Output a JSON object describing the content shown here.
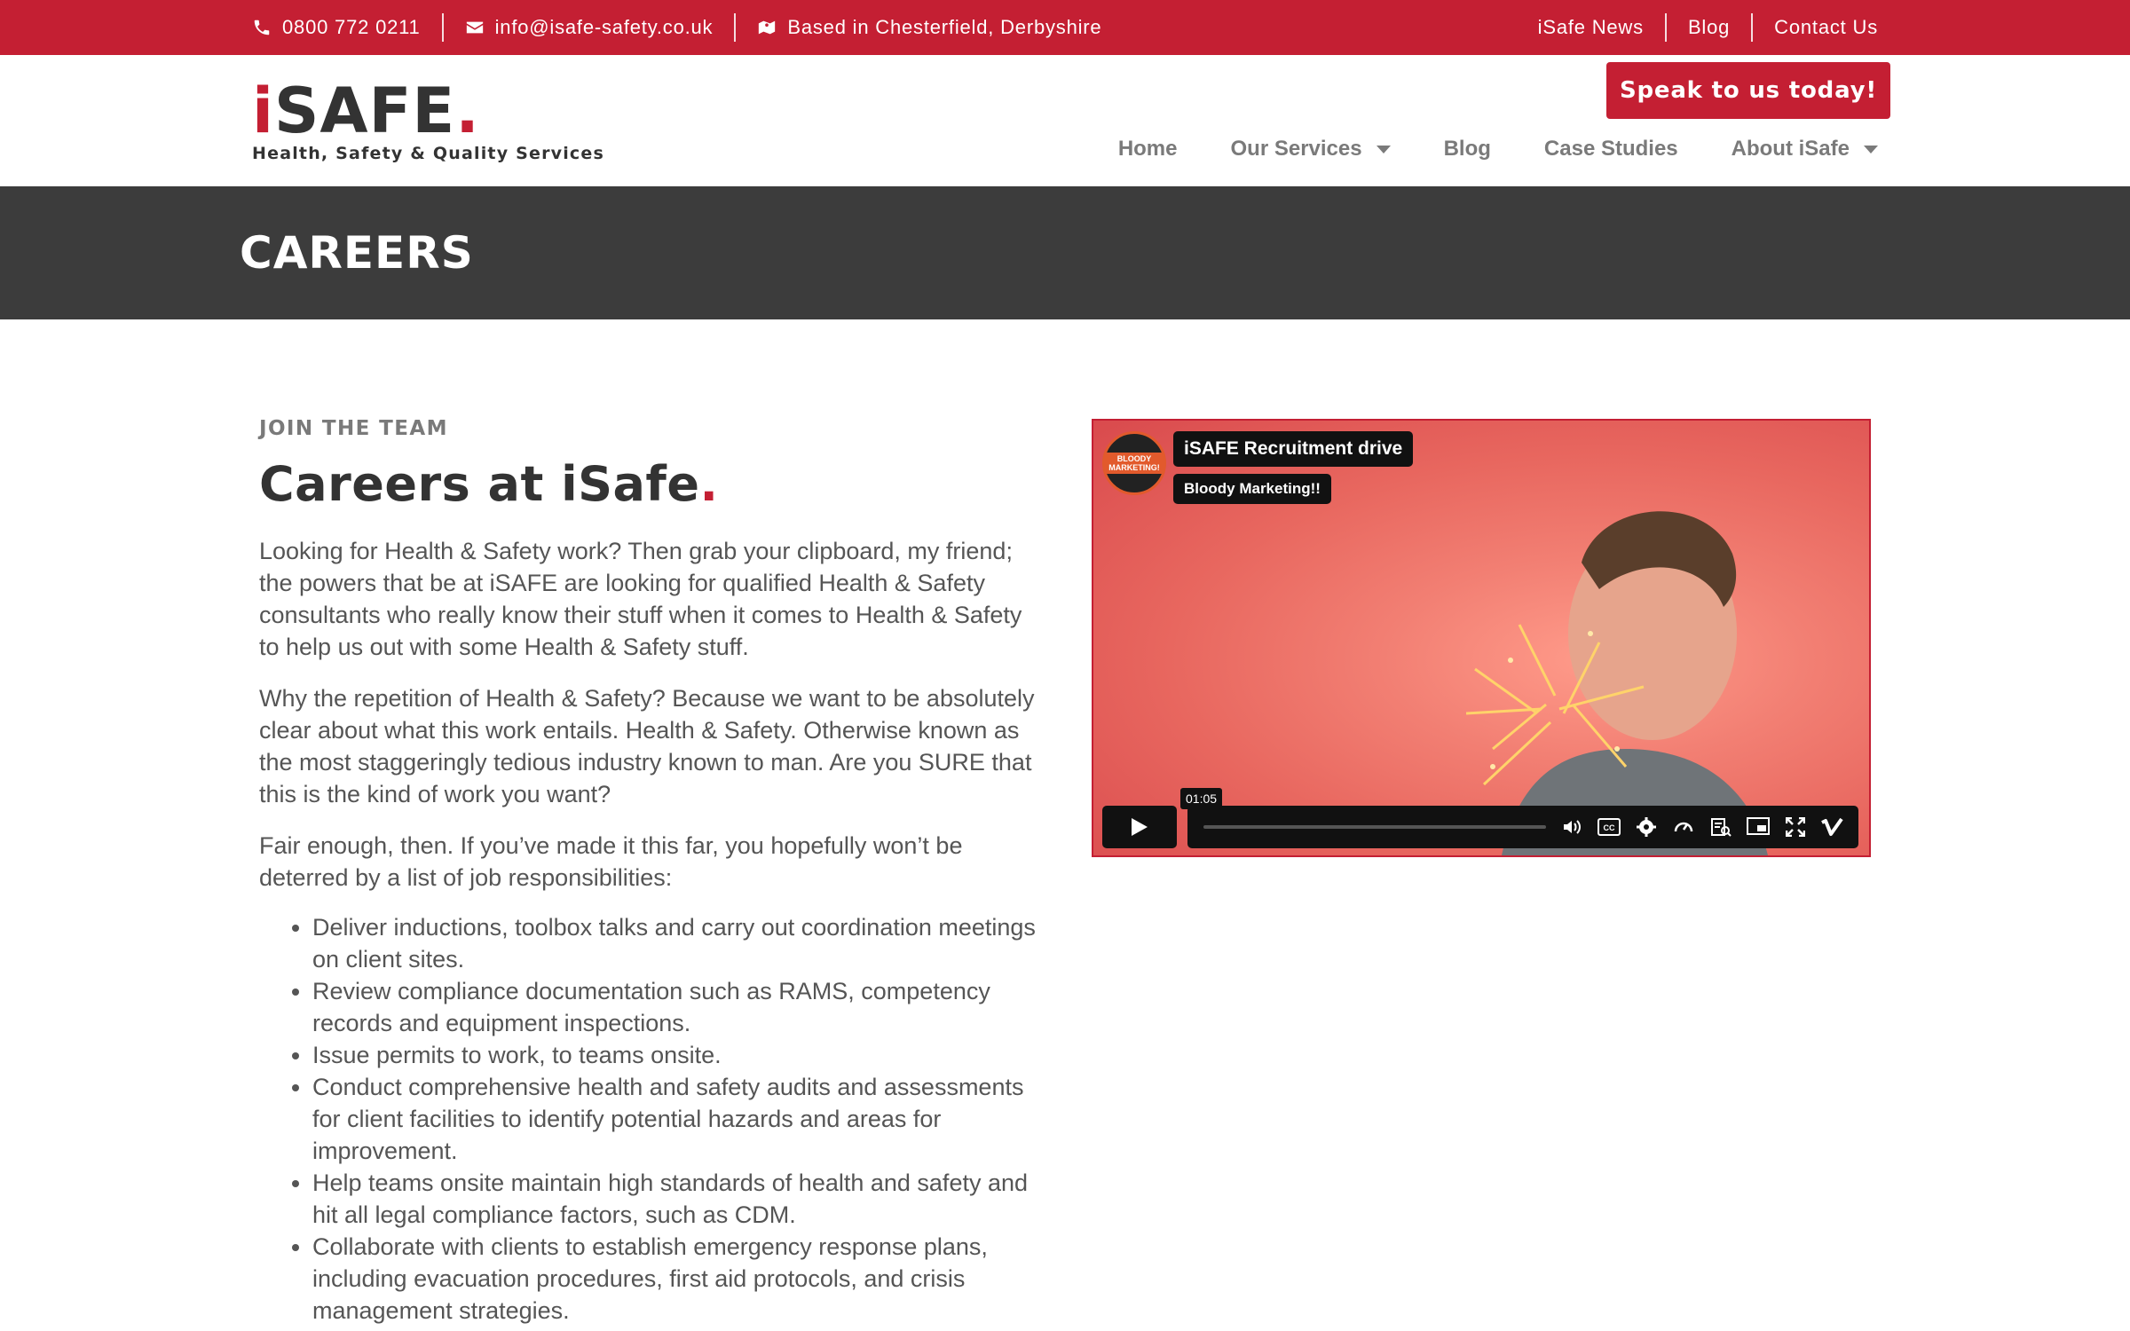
{
  "topbar": {
    "phone": "0800 772 0211",
    "email": "info@isafe-safety.co.uk",
    "location": "Based in Chesterfield, Derbyshire",
    "links": [
      "iSafe News",
      "Blog",
      "Contact Us"
    ]
  },
  "header": {
    "logo_main": "iSAFE",
    "logo_tagline": "Health, Safety & Quality Services",
    "cta_label": "Speak to us today!",
    "nav": [
      {
        "label": "Home",
        "has_caret": false
      },
      {
        "label": "Our Services",
        "has_caret": true
      },
      {
        "label": "Blog",
        "has_caret": false
      },
      {
        "label": "Case Studies",
        "has_caret": false
      },
      {
        "label": "About iSafe",
        "has_caret": true
      }
    ]
  },
  "page": {
    "title": "CAREERS"
  },
  "content": {
    "eyebrow": "JOIN THE TEAM",
    "heading": "Careers at iSafe",
    "heading_dot": ".",
    "paragraphs": [
      "Looking for Health & Safety work? Then grab your clipboard, my friend; the powers that be at iSAFE are looking for qualified Health & Safety consultants who really know their stuff when it comes to Health & Safety to help us out with some Health & Safety stuff.",
      "Why the repetition of Health & Safety? Because we want to be absolutely clear about what this work entails. Health & Safety. Otherwise known as the most staggeringly tedious industry known to man. Are you SURE that this is the kind of work you want?",
      "Fair enough, then. If you’ve made it this far, you hopefully won’t be deterred by a list of job responsibilities:"
    ],
    "responsibilities": [
      "Deliver inductions, toolbox talks and carry out coordination meetings on client sites.",
      "Review compliance documentation such as RAMS, competency records and equipment inspections.",
      "Issue permits to work, to teams onsite.",
      "Conduct comprehensive health and safety audits and assessments for client facilities to identify potential hazards and areas for improvement.",
      "Help teams onsite maintain high standards of health and safety and hit all legal compliance factors, such as CDM.",
      "Collaborate with clients to establish emergency response plans, including evacuation procedures, first aid protocols, and crisis management strategies."
    ]
  },
  "video": {
    "title": "iSAFE Recruitment drive",
    "channel": "Bloody Marketing!!",
    "badge_text": "BLOODY MARKETING!",
    "duration": "01:05",
    "cc_label": "CC",
    "icons": [
      "play-icon",
      "volume-icon",
      "captions-icon",
      "settings-icon",
      "speed-icon",
      "transcript-icon",
      "pip-icon",
      "fullscreen-icon",
      "vimeo-icon"
    ]
  },
  "colors": {
    "brand_red": "#c41f33",
    "dark_band": "#3c3c3c",
    "nav_gray": "#7a7a7a"
  }
}
